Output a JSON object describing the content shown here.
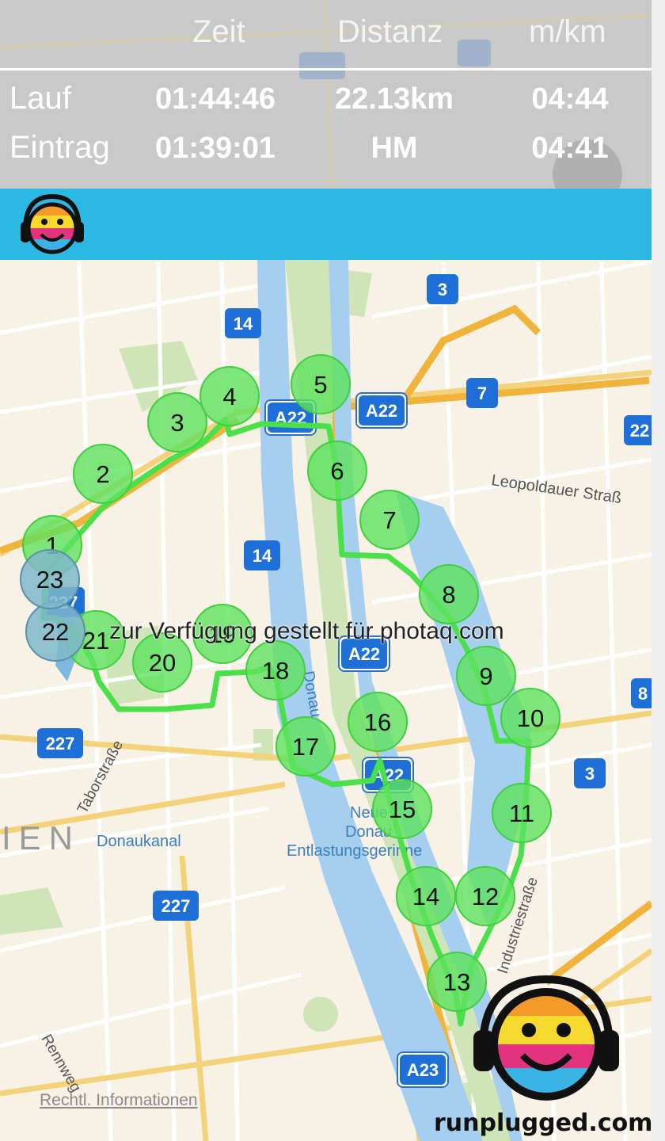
{
  "stats": {
    "headers": [
      "Zeit",
      "Distanz",
      "m/km"
    ],
    "rows": [
      {
        "label": "Lauf",
        "zeit": "01:44:46",
        "distanz": "22.13km",
        "pace": "04:44"
      },
      {
        "label": "Eintrag",
        "zeit": "01:39:01",
        "distanz": "HM",
        "pace": "04:41"
      }
    ]
  },
  "colors": {
    "banner": "#2bb9e4",
    "route": "#4ae04a",
    "marker": "#5ee25e",
    "marker_start_end": "#7fb9c9"
  },
  "map": {
    "labels": {
      "leopoldauer": "Leopoldauer Straß",
      "taborstrasse": "Taborstraße",
      "donaukanal": "Donaukanal",
      "donau": "Donau",
      "neue_donau_1": "Neue",
      "neue_donau_2": "Donau",
      "entlastung": "Entlastungsgerinne",
      "industriestrasse": "Industriestraße",
      "wien": "IEN",
      "rennweg": "Rennweg"
    },
    "shields": {
      "r14a": "14",
      "r14b": "14",
      "r3a": "3",
      "r3b": "3",
      "r3top": "3",
      "r7": "7",
      "r22r": "22",
      "r8r": "8",
      "a22a": "A22",
      "a22b": "A22",
      "a22c": "A22",
      "a22d": "A22",
      "a22top": "A22",
      "a23": "A23",
      "b227a": "227",
      "b227b": "227",
      "b227c": "227"
    },
    "markers": [
      "1",
      "2",
      "3",
      "4",
      "5",
      "6",
      "7",
      "8",
      "9",
      "10",
      "11",
      "12",
      "13",
      "14",
      "15",
      "16",
      "17",
      "18",
      "19",
      "20",
      "21",
      "22",
      "23"
    ]
  },
  "attribution": "Rechtl. Informationen",
  "brand": "runplugged.com",
  "watermark": "zur Verfügung gestellt für photaq.com"
}
